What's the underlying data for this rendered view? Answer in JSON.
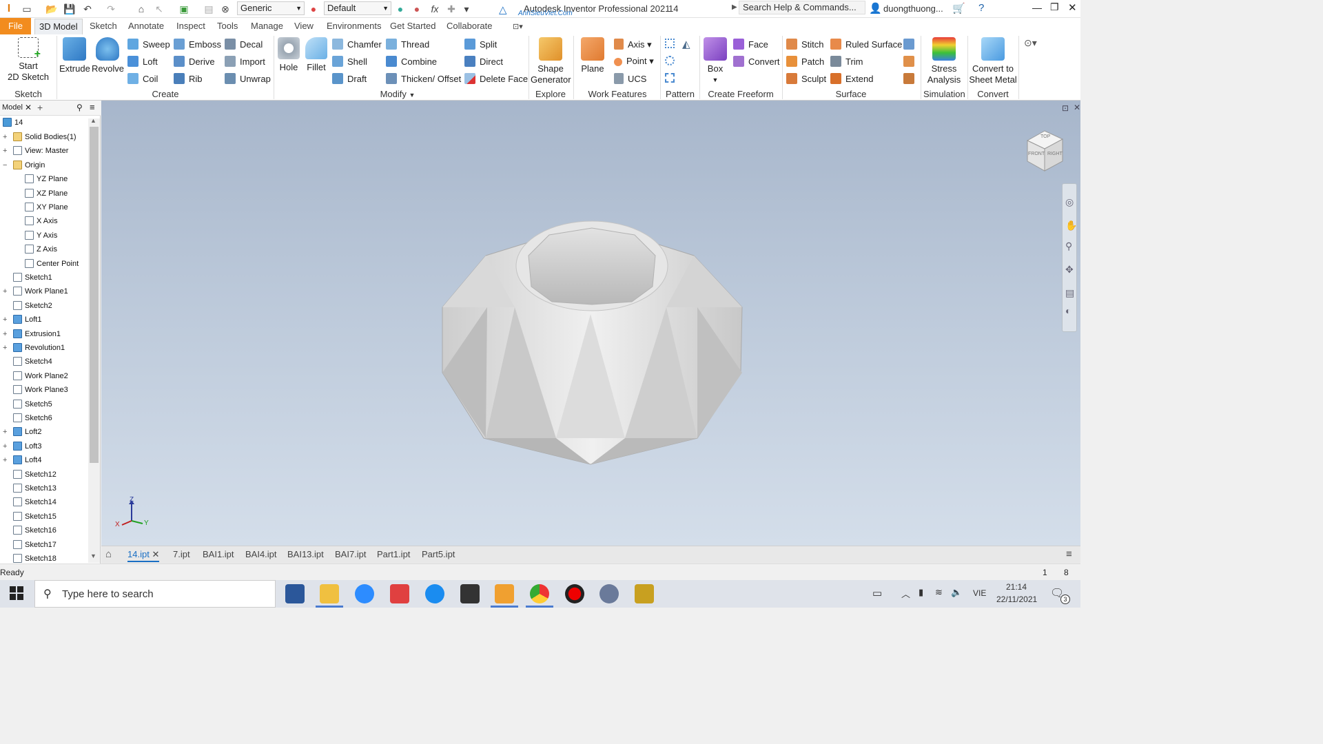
{
  "window": {
    "title": "Autodesk Inventor Professional 2021",
    "doc_number": "14",
    "watermark": "AnhSieuViet.Com",
    "search_placeholder": "Search Help & Commands...",
    "user": "duongthuong..."
  },
  "qat": {
    "appearance_combo": "Generic",
    "style_combo": "Default"
  },
  "tabs": [
    "File",
    "3D Model",
    "Sketch",
    "Annotate",
    "Inspect",
    "Tools",
    "Manage",
    "View",
    "Environments",
    "Get Started",
    "Collaborate"
  ],
  "ribbon": {
    "sketch": {
      "start_line1": "Start",
      "start_line2": "2D Sketch",
      "group": "Sketch"
    },
    "create": {
      "extrude": "Extrude",
      "revolve": "Revolve",
      "sweep": "Sweep",
      "loft": "Loft",
      "coil": "Coil",
      "emboss": "Emboss",
      "derive": "Derive",
      "rib": "Rib",
      "decal": "Decal",
      "import": "Import",
      "unwrap": "Unwrap",
      "group": "Create"
    },
    "modify": {
      "hole": "Hole",
      "fillet": "Fillet",
      "chamfer": "Chamfer",
      "shell": "Shell",
      "draft": "Draft",
      "thread": "Thread",
      "combine": "Combine",
      "thicken": "Thicken/ Offset",
      "split": "Split",
      "direct": "Direct",
      "delete_face": "Delete Face",
      "group": "Modify"
    },
    "explore": {
      "shape_line1": "Shape",
      "shape_line2": "Generator",
      "group": "Explore"
    },
    "work": {
      "plane": "Plane",
      "axis": "Axis",
      "point": "Point",
      "ucs": "UCS",
      "group": "Work Features"
    },
    "pattern": {
      "group": "Pattern"
    },
    "freeform": {
      "box": "Box",
      "face": "Face",
      "convert": "Convert",
      "group": "Create Freeform"
    },
    "surface": {
      "stitch": "Stitch",
      "patch": "Patch",
      "sculpt": "Sculpt",
      "ruled": "Ruled Surface",
      "trim": "Trim",
      "extend": "Extend",
      "group": "Surface"
    },
    "simulation": {
      "stress_line1": "Stress",
      "stress_line2": "Analysis",
      "group": "Simulation"
    },
    "convert": {
      "line1": "Convert to",
      "line2": "Sheet Metal",
      "group": "Convert"
    }
  },
  "browser": {
    "tab": "Model",
    "root": "14",
    "items": [
      {
        "label": "Solid Bodies(1)",
        "expand": "+"
      },
      {
        "label": "View: Master",
        "expand": "+"
      },
      {
        "label": "Origin",
        "expand": "−"
      },
      {
        "label": "YZ Plane",
        "expand": ""
      },
      {
        "label": "XZ Plane",
        "expand": ""
      },
      {
        "label": "XY Plane",
        "expand": ""
      },
      {
        "label": "X Axis",
        "expand": ""
      },
      {
        "label": "Y Axis",
        "expand": ""
      },
      {
        "label": "Z Axis",
        "expand": ""
      },
      {
        "label": "Center Point",
        "expand": ""
      },
      {
        "label": "Sketch1",
        "expand": ""
      },
      {
        "label": "Work Plane1",
        "expand": "+"
      },
      {
        "label": "Sketch2",
        "expand": ""
      },
      {
        "label": "Loft1",
        "expand": "+"
      },
      {
        "label": "Extrusion1",
        "expand": "+"
      },
      {
        "label": "Revolution1",
        "expand": "+"
      },
      {
        "label": "Sketch4",
        "expand": ""
      },
      {
        "label": "Work Plane2",
        "expand": ""
      },
      {
        "label": "Work Plane3",
        "expand": ""
      },
      {
        "label": "Sketch5",
        "expand": ""
      },
      {
        "label": "Sketch6",
        "expand": ""
      },
      {
        "label": "Loft2",
        "expand": "+"
      },
      {
        "label": "Loft3",
        "expand": "+"
      },
      {
        "label": "Loft4",
        "expand": "+"
      },
      {
        "label": "Sketch12",
        "expand": ""
      },
      {
        "label": "Sketch13",
        "expand": ""
      },
      {
        "label": "Sketch14",
        "expand": ""
      },
      {
        "label": "Sketch15",
        "expand": ""
      },
      {
        "label": "Sketch16",
        "expand": ""
      },
      {
        "label": "Sketch17",
        "expand": ""
      },
      {
        "label": "Sketch18",
        "expand": ""
      }
    ]
  },
  "viewport": {
    "viewcube_labels": {
      "front": "FRONT",
      "right": "RIGHT",
      "top": "TOP"
    },
    "triad": {
      "x": "X",
      "y": "Y",
      "z": "Z"
    }
  },
  "doc_tabs": [
    "14.ipt",
    "7.ipt",
    "BAI1.ipt",
    "BAI4.ipt",
    "BAI13.ipt",
    "BAI7.ipt",
    "Part1.ipt",
    "Part5.ipt"
  ],
  "status": {
    "text": "Ready",
    "count1": "1",
    "count2": "8"
  },
  "taskbar": {
    "search_placeholder": "Type here to search",
    "lang": "VIE",
    "time": "21:14",
    "date": "22/11/2021",
    "notif_count": "3"
  }
}
